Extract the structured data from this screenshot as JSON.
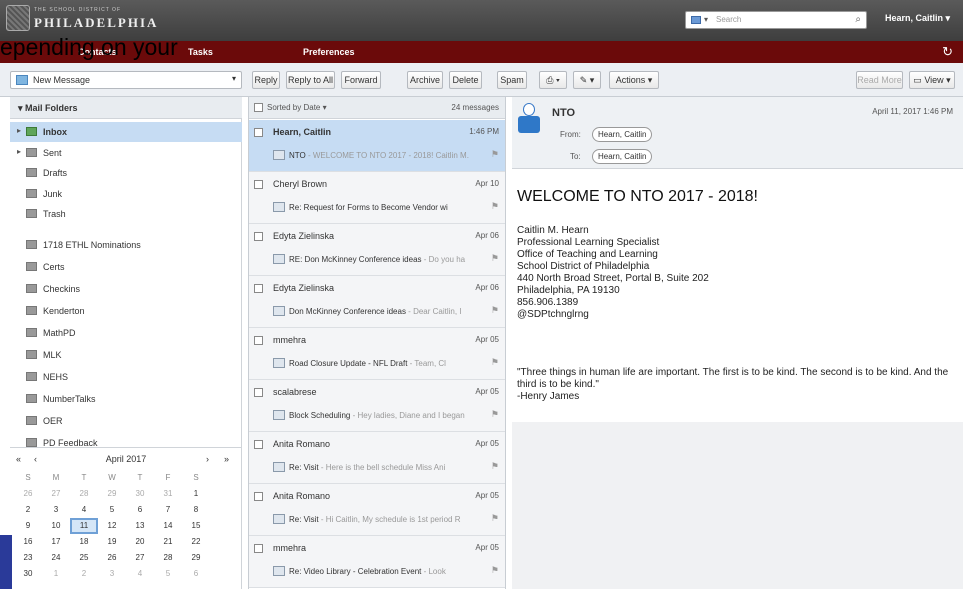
{
  "header": {
    "logo_small": "THE SCHOOL DISTRICT OF",
    "logo_big": "PHILADELPHIA",
    "search_placeholder": "Search",
    "user": "Hearn, Caitlin"
  },
  "nav": {
    "tabs": [
      "Contacts",
      "Tasks",
      "Preferences"
    ],
    "overlay_text": "epending on your"
  },
  "toolbar": {
    "new_message": "New Message",
    "buttons": [
      "Reply",
      "Reply to All",
      "Forward",
      "Archive",
      "Delete",
      "Spam",
      "Actions"
    ],
    "read_more": "Read More",
    "view": "View"
  },
  "folders": {
    "header": "Mail Folders",
    "items": [
      "Inbox",
      "Sent",
      "Drafts",
      "Junk",
      "Trash",
      "1718 ETHL Nominations",
      "Certs",
      "Checkins",
      "Kenderton",
      "MathPD",
      "MLK",
      "NEHS",
      "NumberTalks",
      "OER",
      "PD Feedback"
    ]
  },
  "calendar": {
    "month": "April 2017",
    "dow": [
      "S",
      "M",
      "T",
      "W",
      "T",
      "F",
      "S"
    ],
    "weeks": [
      [
        "26",
        "27",
        "28",
        "29",
        "30",
        "31",
        "1"
      ],
      [
        "2",
        "3",
        "4",
        "5",
        "6",
        "7",
        "8"
      ],
      [
        "9",
        "10",
        "11",
        "12",
        "13",
        "14",
        "15"
      ],
      [
        "16",
        "17",
        "18",
        "19",
        "20",
        "21",
        "22"
      ],
      [
        "23",
        "24",
        "25",
        "26",
        "27",
        "28",
        "29"
      ],
      [
        "30",
        "1",
        "2",
        "3",
        "4",
        "5",
        "6"
      ]
    ],
    "today": "11"
  },
  "list": {
    "sort": "Sorted by Date",
    "count": "24 messages",
    "messages": [
      {
        "sender": "Hearn, Caitlin",
        "date": "1:46 PM",
        "subject": "NTO",
        "preview": " - WELCOME TO NTO 2017 - 2018! Caitlin M."
      },
      {
        "sender": "Cheryl Brown",
        "date": "Apr 10",
        "subject": "Re: Request for Forms to Become Vendor wi",
        "preview": ""
      },
      {
        "sender": "Edyta Zielinska",
        "date": "Apr 06",
        "subject": "RE: Don McKinney Conference ideas",
        "preview": " - Do you ha"
      },
      {
        "sender": "Edyta Zielinska",
        "date": "Apr 06",
        "subject": "Don McKinney Conference ideas",
        "preview": " - Dear Caitlin, I"
      },
      {
        "sender": "mmehra",
        "date": "Apr 05",
        "subject": "Road Closure Update - NFL Draft",
        "preview": " - Team, Cl"
      },
      {
        "sender": "scalabrese",
        "date": "Apr 05",
        "subject": "Block Scheduling",
        "preview": " - Hey ladies, Diane and I began"
      },
      {
        "sender": "Anita Romano",
        "date": "Apr 05",
        "subject": "Re: Visit",
        "preview": " - Here is the bell schedule Miss Ani"
      },
      {
        "sender": "Anita Romano",
        "date": "Apr 05",
        "subject": "Re: Visit",
        "preview": " - Hi Caitlin, My schedule is 1st period R"
      },
      {
        "sender": "mmehra",
        "date": "Apr 05",
        "subject": "Re: Video Library - Celebration Event",
        "preview": " - Look"
      }
    ]
  },
  "reader": {
    "subject": "NTO",
    "date": "April 11, 2017 1:46 PM",
    "from_label": "From:",
    "from": "Hearn, Caitlin",
    "to_label": "To:",
    "to": "Hearn, Caitlin",
    "title": "WELCOME TO NTO 2017 - 2018!",
    "lines": [
      "Caitlin M. Hearn",
      "Professional Learning Specialist",
      "Office of Teaching and Learning",
      "School District of Philadelphia",
      "440 North Broad Street, Portal B, Suite 202",
      "Philadelphia, PA 19130",
      "856.906.1389",
      "@SDPtchnglrng"
    ],
    "quote1": "\"Three things in human life are important. The first is to be kind. The second is to be kind. And the third is to be kind.\"",
    "quote2": "-Henry James"
  }
}
